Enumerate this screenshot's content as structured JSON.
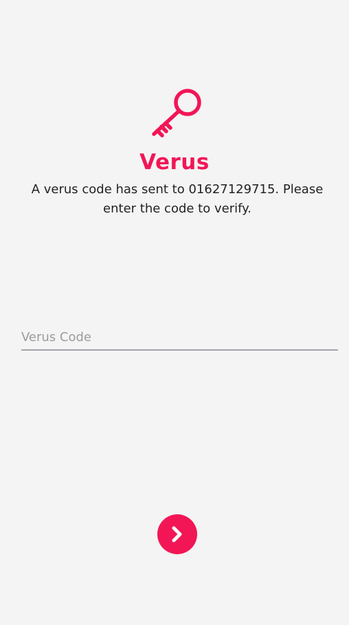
{
  "app": {
    "accent_color": "#f21656",
    "background_color": "#f4f4f4"
  },
  "header": {
    "icon": "key-icon",
    "title": "Verus",
    "message": "A verus code has sent to 01627129715. Please enter the code to verify."
  },
  "form": {
    "code_field": {
      "value": "",
      "placeholder": "Verus Code"
    }
  },
  "actions": {
    "next_button_icon": "chevron-right-icon"
  }
}
